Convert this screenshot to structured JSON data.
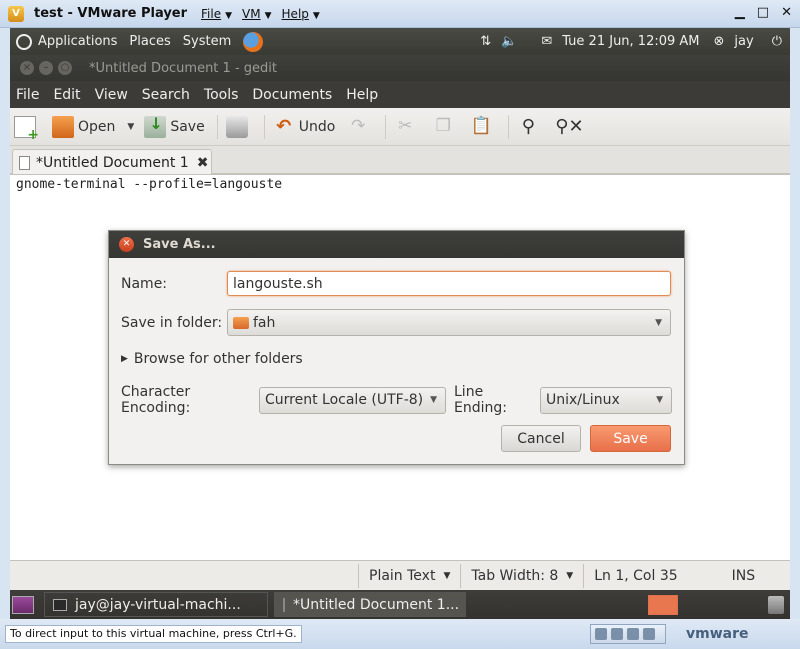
{
  "vmware": {
    "title": "test - VMware Player",
    "menus": [
      "File",
      "VM",
      "Help"
    ],
    "controls": [
      "▁",
      "□",
      "✕"
    ],
    "status_hint": "To direct input to this virtual machine, press Ctrl+G.",
    "brand": "vmware"
  },
  "top_panel": {
    "menus": [
      "Applications",
      "Places",
      "System"
    ],
    "datetime": "Tue 21 Jun, 12:09 AM",
    "user": "jay"
  },
  "gedit": {
    "window_title": "*Untitled Document 1 - gedit",
    "menubar": [
      "File",
      "Edit",
      "View",
      "Search",
      "Tools",
      "Documents",
      "Help"
    ],
    "toolbar": {
      "open": "Open",
      "save": "Save",
      "undo": "Undo"
    },
    "tab_label": "*Untitled Document 1",
    "content": "gnome-terminal --profile=langouste",
    "status": {
      "language": "Plain Text",
      "tab_width": "Tab Width:  8",
      "position": "Ln 1, Col 35",
      "mode": "INS"
    }
  },
  "save_dialog": {
    "title": "Save As...",
    "name_label": "Name:",
    "name_value": "langouste.sh",
    "folder_label": "Save in folder:",
    "folder_value": "fah",
    "browse_label": "Browse for other folders",
    "encoding_label": "Character Encoding:",
    "encoding_value": "Current Locale (UTF-8)",
    "line_ending_label": "Line Ending:",
    "line_ending_value": "Unix/Linux",
    "cancel_label": "Cancel",
    "save_label": "Save"
  },
  "taskbar": {
    "tasks": [
      "jay@jay-virtual-machi...",
      "*Untitled Document 1..."
    ]
  },
  "colors": {
    "accent": "#e8764e",
    "panel": "#3c3b37"
  }
}
